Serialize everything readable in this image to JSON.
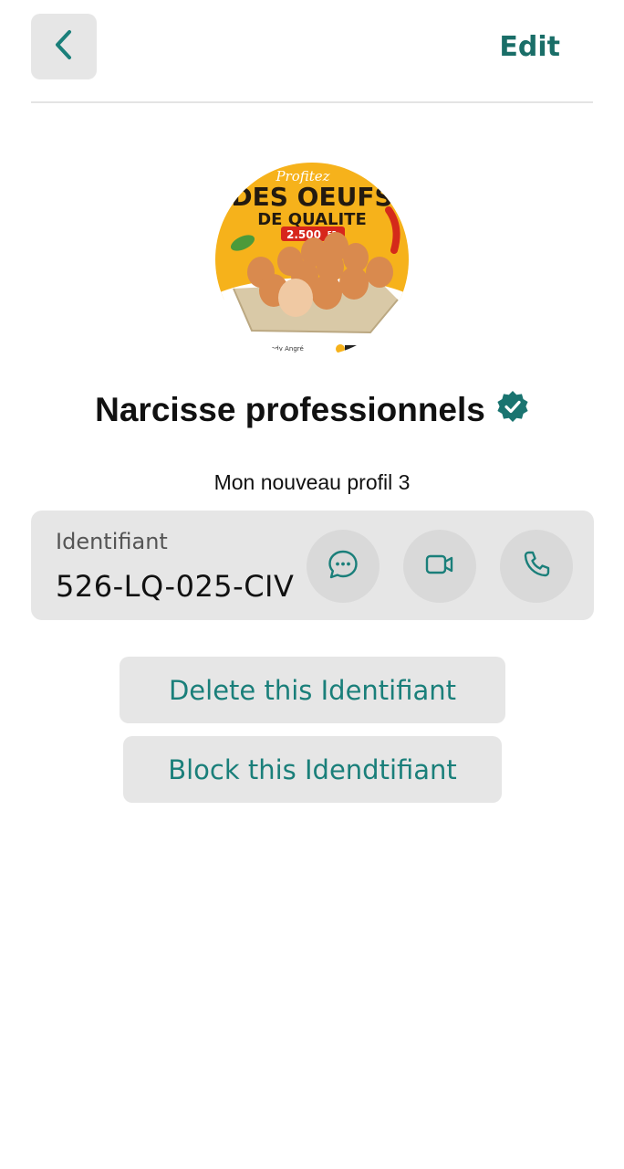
{
  "header": {
    "back_icon": "chevron-left-icon",
    "edit_label": "Edit"
  },
  "avatar": {
    "headline_script": "Profitez",
    "headline_main": "DES OEUFS",
    "headline_sub": "DE QUALITE",
    "price": "2.500",
    "price_unit": "FR",
    "footer_text": "Cocody Angré"
  },
  "profile": {
    "name": "Narcisse professionnels",
    "verified_icon": "verified-badge-icon",
    "subtitle": "Mon nouveau profil 3"
  },
  "identifier": {
    "label": "Identifiant",
    "value": "526-LQ-025-CIV",
    "actions": [
      {
        "icon": "chat-bubble-icon"
      },
      {
        "icon": "video-camera-icon"
      },
      {
        "icon": "phone-icon"
      }
    ]
  },
  "buttons": {
    "delete_label": "Delete this Identifiant",
    "block_label": "Block this Idendtifiant"
  },
  "colors": {
    "accent": "#1a7f7a",
    "accent_dark": "#1a6e68",
    "surface": "#e6e6e6",
    "avatar_yellow": "#f6b21b"
  }
}
